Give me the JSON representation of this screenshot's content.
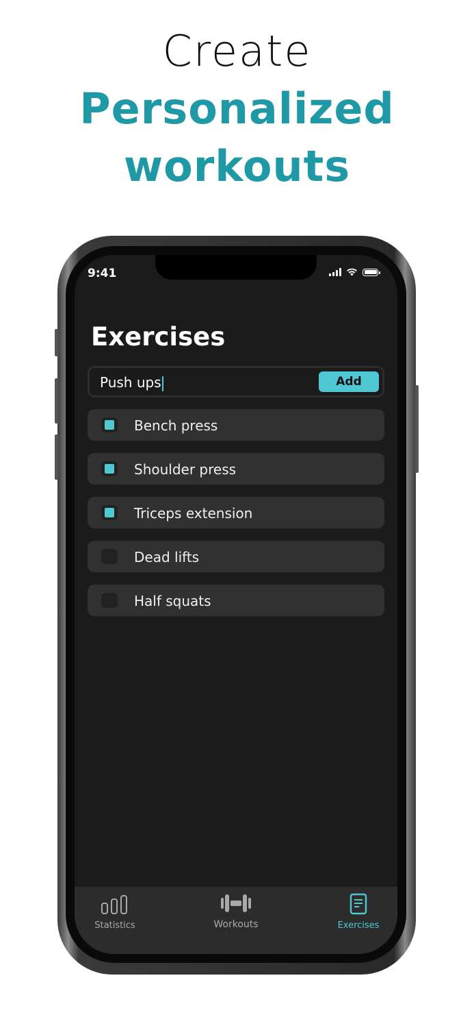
{
  "headline": {
    "line1": "Create",
    "line2": "Personalized",
    "line3": "workouts"
  },
  "status_bar": {
    "time": "9:41"
  },
  "screen": {
    "title": "Exercises",
    "input": {
      "value": "Push ups"
    },
    "add_button": "Add"
  },
  "exercises": [
    {
      "label": "Bench press",
      "checked": true
    },
    {
      "label": "Shoulder press",
      "checked": true
    },
    {
      "label": "Triceps extension",
      "checked": true
    },
    {
      "label": "Dead lifts",
      "checked": false
    },
    {
      "label": "Half squats",
      "checked": false
    }
  ],
  "tabs": [
    {
      "label": "Statistics",
      "icon": "bar-chart-icon",
      "active": false
    },
    {
      "label": "Workouts",
      "icon": "dumbbell-icon",
      "active": false
    },
    {
      "label": "Exercises",
      "icon": "document-icon",
      "active": true
    }
  ],
  "colors": {
    "accent": "#4fc8d4",
    "headline_accent": "#1e99a5",
    "screen_bg": "#1b1b1b",
    "row_bg": "#313131",
    "tabbar_bg": "#2c2c2c",
    "tab_inactive": "#a9a9a9"
  }
}
